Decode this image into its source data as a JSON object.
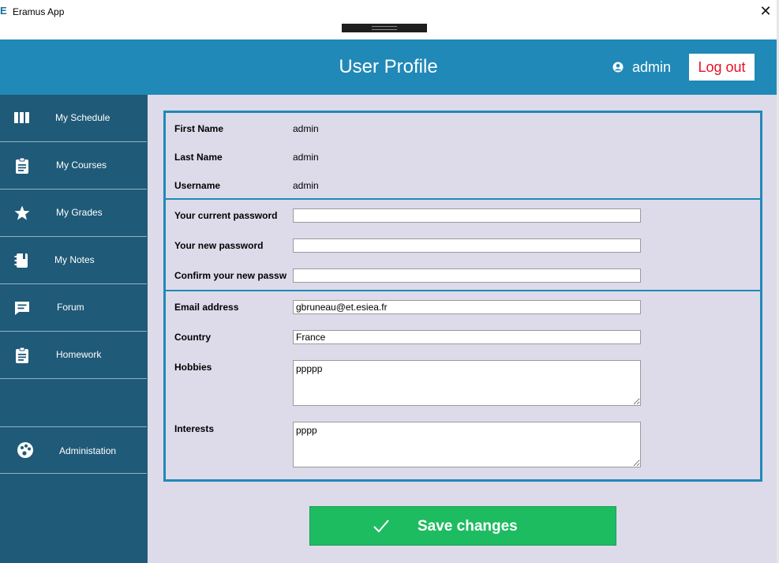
{
  "window": {
    "logo": "E",
    "title": "Eramus App",
    "close_glyph": "✕"
  },
  "header": {
    "title": "User Profile",
    "user_icon": "user-circle-icon",
    "username": "admin",
    "logout_label": "Log out",
    "logout_color": "#e81123",
    "background": "#2089b7"
  },
  "sidebar": {
    "background": "#1f5a78",
    "items": [
      {
        "label": "My Schedule",
        "icon": "schedule-columns-icon"
      },
      {
        "label": "My Courses",
        "icon": "clipboard-icon"
      },
      {
        "label": "My Grades",
        "icon": "star-icon"
      },
      {
        "label": "My Notes",
        "icon": "notebook-icon"
      },
      {
        "label": "Forum",
        "icon": "chat-bubble-icon"
      },
      {
        "label": "Homework",
        "icon": "clipboard-icon"
      }
    ],
    "admin_item": {
      "label": "Administation",
      "icon": "palette-icon"
    }
  },
  "profile": {
    "first_name_label": "First Name",
    "first_name_value": "admin",
    "last_name_label": "Last Name",
    "last_name_value": "admin",
    "username_label": "Username",
    "username_value": "admin",
    "current_password_label": "Your current password",
    "current_password_value": "",
    "new_password_label": "Your new password",
    "new_password_value": "",
    "confirm_password_label": "Confirm your new passw",
    "confirm_password_value": "",
    "email_label": "Email address",
    "email_value": "gbruneau@et.esiea.fr",
    "country_label": "Country",
    "country_value": "France",
    "hobbies_label": "Hobbies",
    "hobbies_value": "ppppp",
    "interests_label": "Interests",
    "interests_value": "pppp"
  },
  "actions": {
    "save_label": "Save changes",
    "save_color": "#1ebc61",
    "save_icon": "checkmark-icon"
  }
}
